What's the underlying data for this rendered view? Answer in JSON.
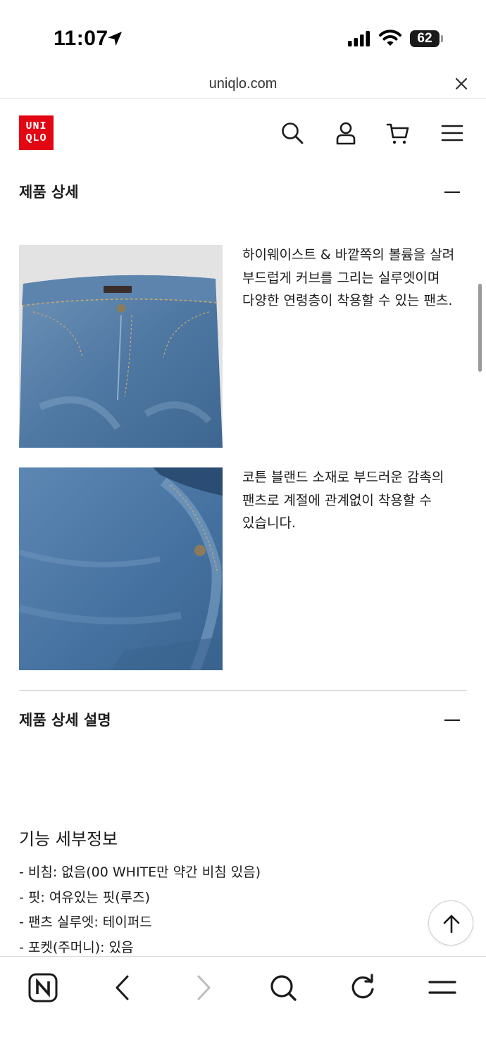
{
  "status_bar": {
    "time": "11:07",
    "battery": "62"
  },
  "browser": {
    "url": "uniqlo.com"
  },
  "header": {
    "logo_line1": "UNI",
    "logo_line2": "QLO",
    "brand_color": "#e30613"
  },
  "sections": {
    "product_details": {
      "title": "제품 상세",
      "items": [
        {
          "text": "하이웨이스트 & 바깥쪽의 볼륨을 살려 부드럽게 커브를 그리는 실루엣이며 다양한 연령층이 착용할 수 있는 팬츠."
        },
        {
          "text": "코튼 블랜드 소재로 부드러운 감촉의 팬츠로 계절에 관계없이 착용할 수 있습니다."
        }
      ]
    },
    "product_description": {
      "title": "제품 상세 설명"
    }
  },
  "features": {
    "title": "기능 세부정보",
    "items": [
      "- 비침: 없음(00 WHITE만 약간 비침 있음)",
      "- 핏: 여유있는 핏(루즈)",
      "- 팬츠 실루엣: 테이퍼드",
      "- 포켓(주머니): 있음"
    ]
  },
  "icons": {
    "header": [
      "search-icon",
      "account-icon",
      "cart-icon",
      "menu-icon"
    ],
    "bottom_nav": [
      "naver-home-icon",
      "back-icon",
      "forward-icon",
      "search-icon",
      "reload-icon",
      "menu-icon"
    ]
  }
}
